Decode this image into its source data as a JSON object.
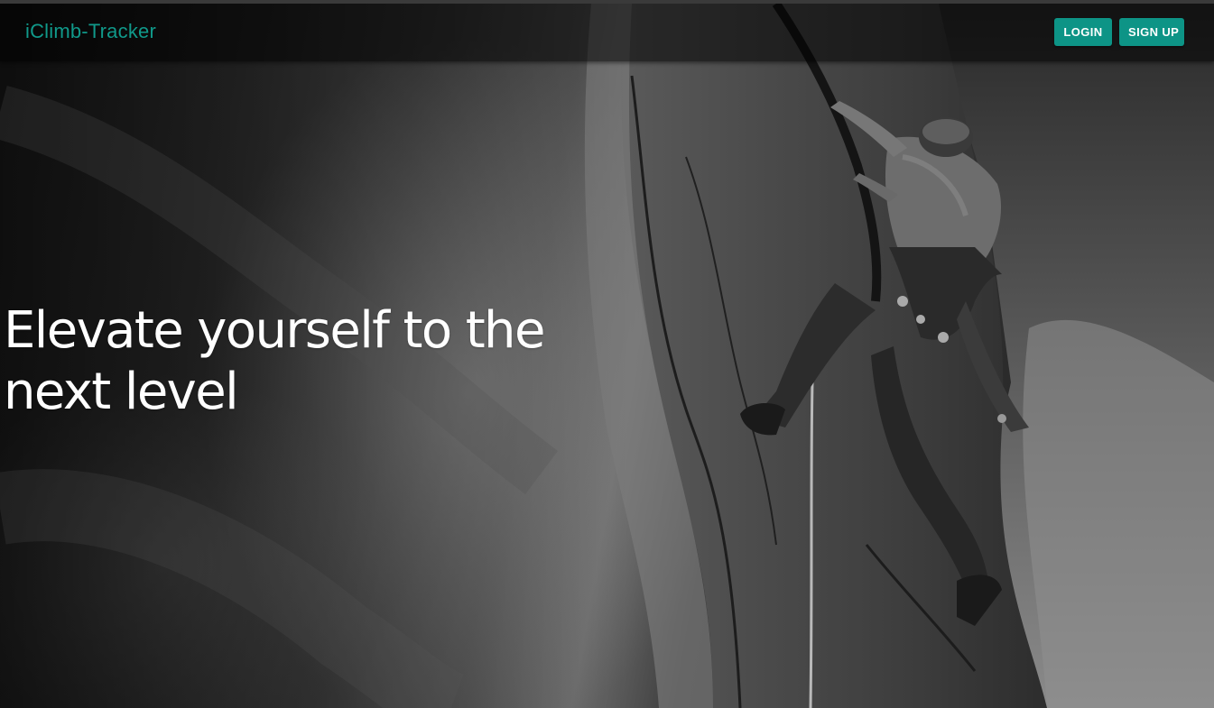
{
  "app": {
    "brand": "iClimb-Tracker"
  },
  "nav": {
    "login_label": "LOGIN",
    "signup_label": "SIGN UP"
  },
  "hero": {
    "headline": "Elevate yourself to the next level",
    "image_description_icon": "climber-photo"
  },
  "colors": {
    "accent": "#0d9486",
    "brand_text": "#10998a",
    "headline_text": "#ffffff"
  }
}
